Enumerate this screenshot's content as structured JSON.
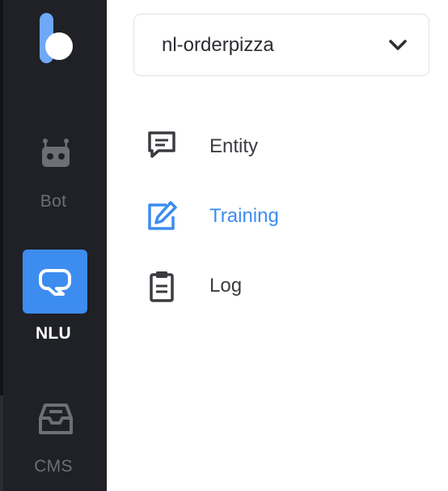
{
  "colors": {
    "rail_background": "#1f2126",
    "accent": "#3d8cf0",
    "rail_muted": "#6c6f75",
    "text": "#3a3c40"
  },
  "sidebar": {
    "logo": "k-logo",
    "items": [
      {
        "label": "Bot",
        "icon": "robot-icon",
        "active": false
      },
      {
        "label": "NLU",
        "icon": "chat-bubble-icon",
        "active": true
      },
      {
        "label": "CMS",
        "icon": "inbox-tray-icon",
        "active": false
      }
    ]
  },
  "project_select": {
    "value": "nl-orderpizza",
    "icon": "chevron-down-icon"
  },
  "menu": {
    "items": [
      {
        "label": "Entity",
        "icon": "message-square-icon",
        "selected": false
      },
      {
        "label": "Training",
        "icon": "edit-pencil-icon",
        "selected": true
      },
      {
        "label": "Log",
        "icon": "clipboard-icon",
        "selected": false
      }
    ]
  }
}
